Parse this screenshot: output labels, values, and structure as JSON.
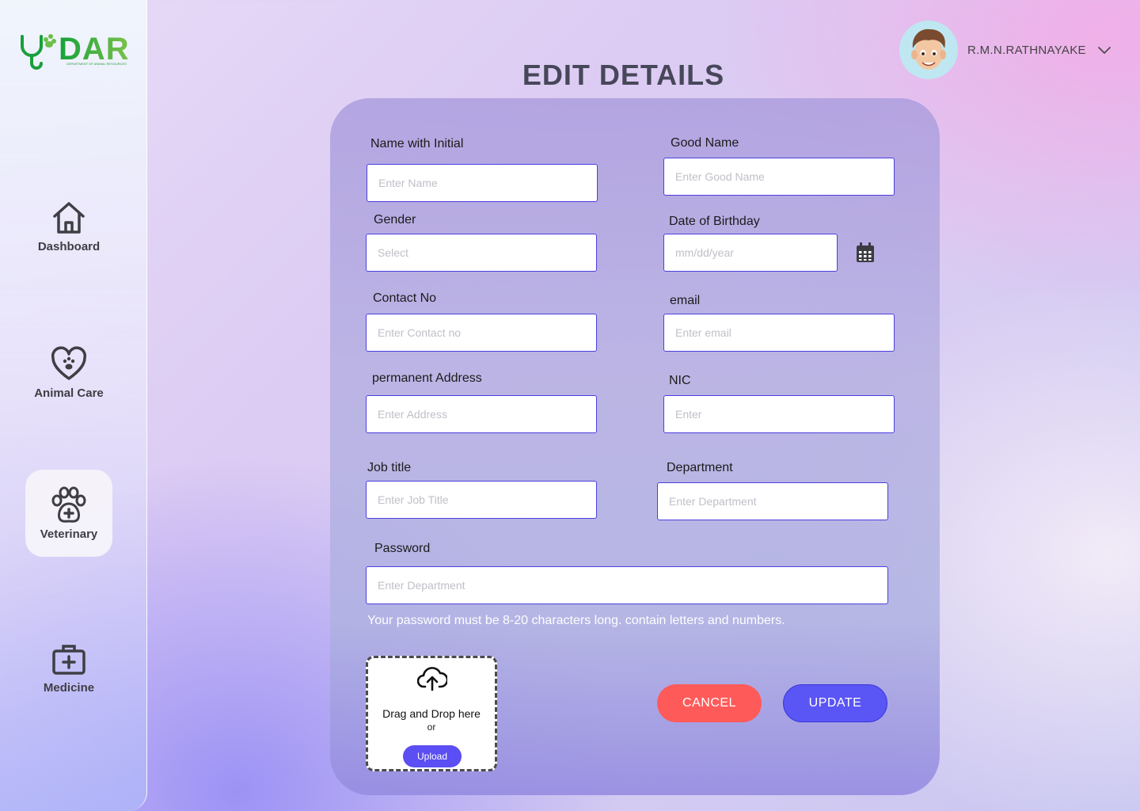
{
  "app": {
    "logo_text": "DAR",
    "logo_subtitle": "DEPARTMENT OF ANIMAL RESOURCES"
  },
  "sidebar": {
    "items": [
      {
        "label": "Dashboard",
        "icon": "home-icon",
        "active": false
      },
      {
        "label": "Animal Care",
        "icon": "heart-paw-icon",
        "active": false
      },
      {
        "label": "Veterinary",
        "icon": "paw-plus-icon",
        "active": true
      },
      {
        "label": "Medicine",
        "icon": "medical-kit-icon",
        "active": false
      }
    ]
  },
  "header": {
    "user_name": "R.M.N.RATHNAYAKE",
    "avatar": "user-avatar",
    "dropdown_icon": "chevron-down-icon"
  },
  "page": {
    "title": "EDIT DETAILS"
  },
  "form": {
    "name_initial": {
      "label": "Name with Initial",
      "placeholder": "Enter Name"
    },
    "good_name": {
      "label": "Good  Name",
      "placeholder": "Enter Good Name"
    },
    "gender": {
      "label": "Gender",
      "placeholder": "Select"
    },
    "dob": {
      "label": "Date of Birthday",
      "placeholder": "mm/dd/year",
      "icon": "calendar-icon"
    },
    "contact": {
      "label": "Contact No",
      "placeholder": "Enter Contact no"
    },
    "email": {
      "label": "email",
      "placeholder": "Enter email"
    },
    "address": {
      "label": "permanent Address",
      "placeholder": "Enter Address"
    },
    "nic": {
      "label": "NIC",
      "placeholder": "Enter"
    },
    "job_title": {
      "label": "Job title",
      "placeholder": "Enter Job Title"
    },
    "department": {
      "label": "Department",
      "placeholder": "Enter Department"
    },
    "password": {
      "label": "Password",
      "placeholder": "Enter Department"
    },
    "password_hint": "Your password must be 8-20 characters long. contain letters and numbers."
  },
  "upload": {
    "icon": "cloud-upload-icon",
    "drag_text": "Drag and Drop here",
    "or_text": "or",
    "button_label": "Upload"
  },
  "actions": {
    "cancel_label": "CANCEL",
    "update_label": "UPDATE"
  },
  "colors": {
    "primary": "#5A55F5",
    "cancel": "#FF5A5A",
    "logo_green": "#15A23A",
    "input_border": "#4B3FE0"
  }
}
